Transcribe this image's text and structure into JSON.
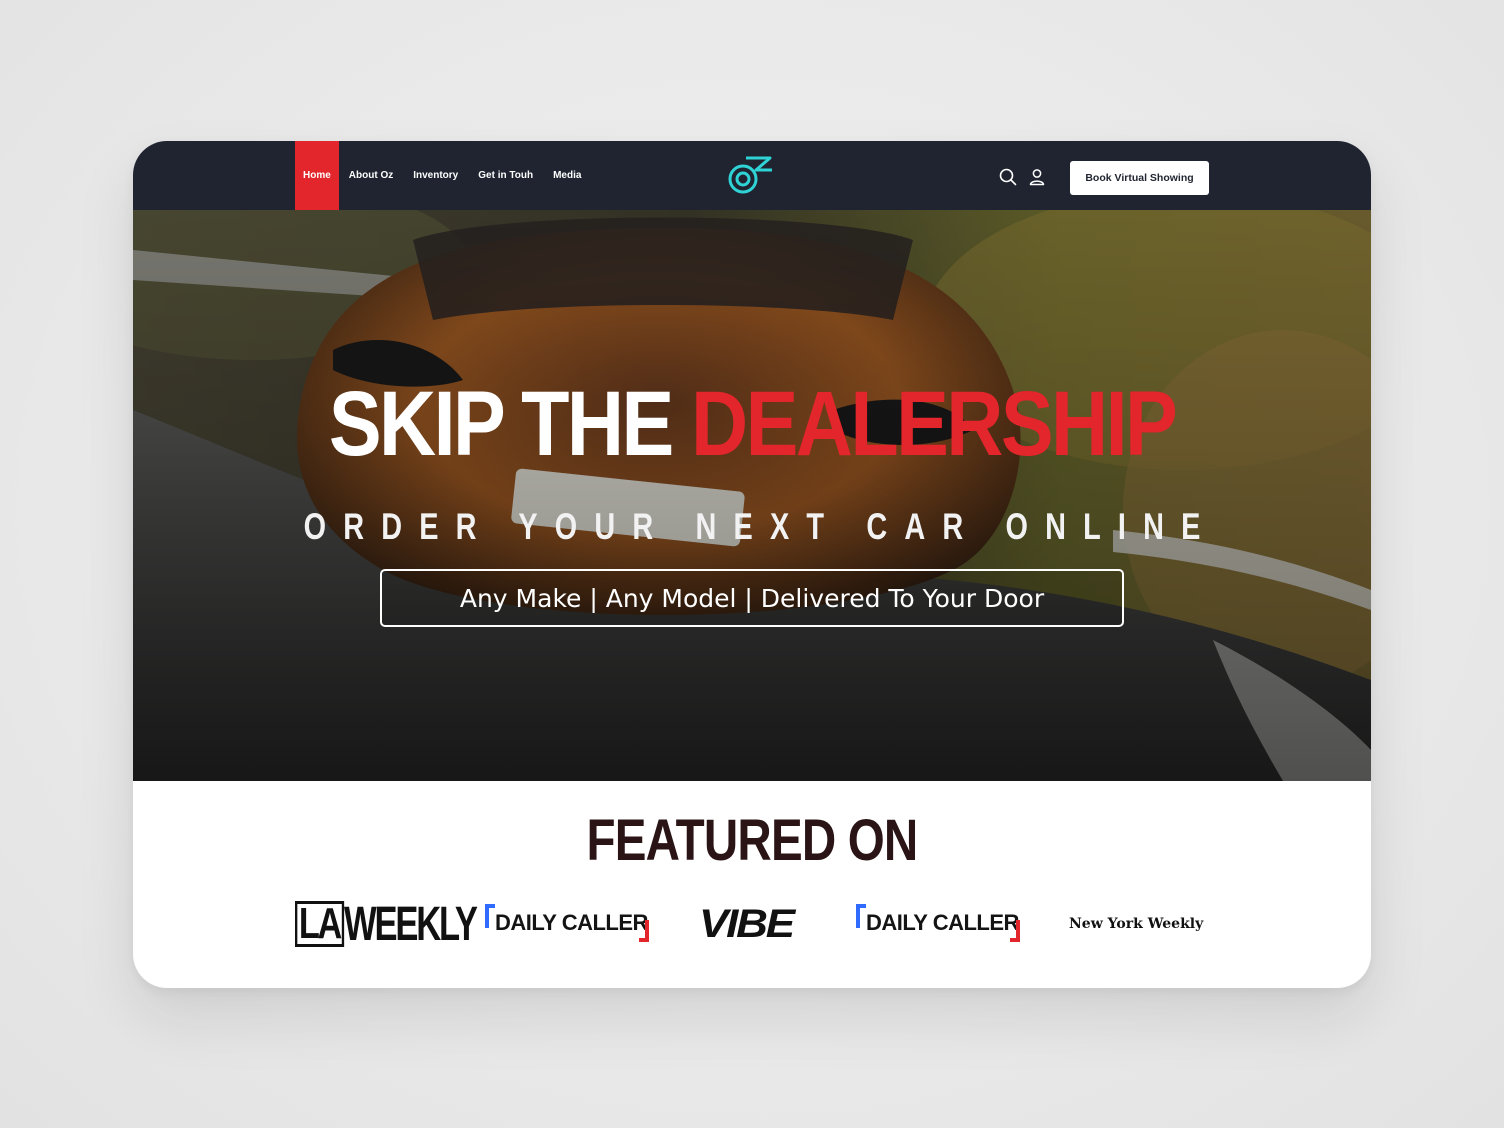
{
  "nav": {
    "links": [
      "Home",
      "About Oz",
      "Inventory",
      "Get in Touh",
      "Media"
    ],
    "active": "Home",
    "cta_label": "Book Virtual Showing",
    "icons": [
      "search-icon",
      "user-icon"
    ],
    "logo": "oz-logo-icon"
  },
  "hero": {
    "title_white": "SKIP THE",
    "title_red": "DEALERSHIP",
    "subtitle": "ORDER YOUR NEXT CAR ONLINE",
    "tagline": "Any Make | Any Model | Delivered To Your Door"
  },
  "featured": {
    "title": "FEATURED ON",
    "logos": [
      "LA",
      "WEEKLY",
      "DAILY CALLER",
      "VIBE",
      "DAILY CALLER",
      "New York Weekly"
    ]
  },
  "colors": {
    "nav_bg": "#1f2430",
    "accent_red": "#e2262b",
    "logo_teal": "#2fd3d6",
    "featured_title": "#2a1416"
  }
}
